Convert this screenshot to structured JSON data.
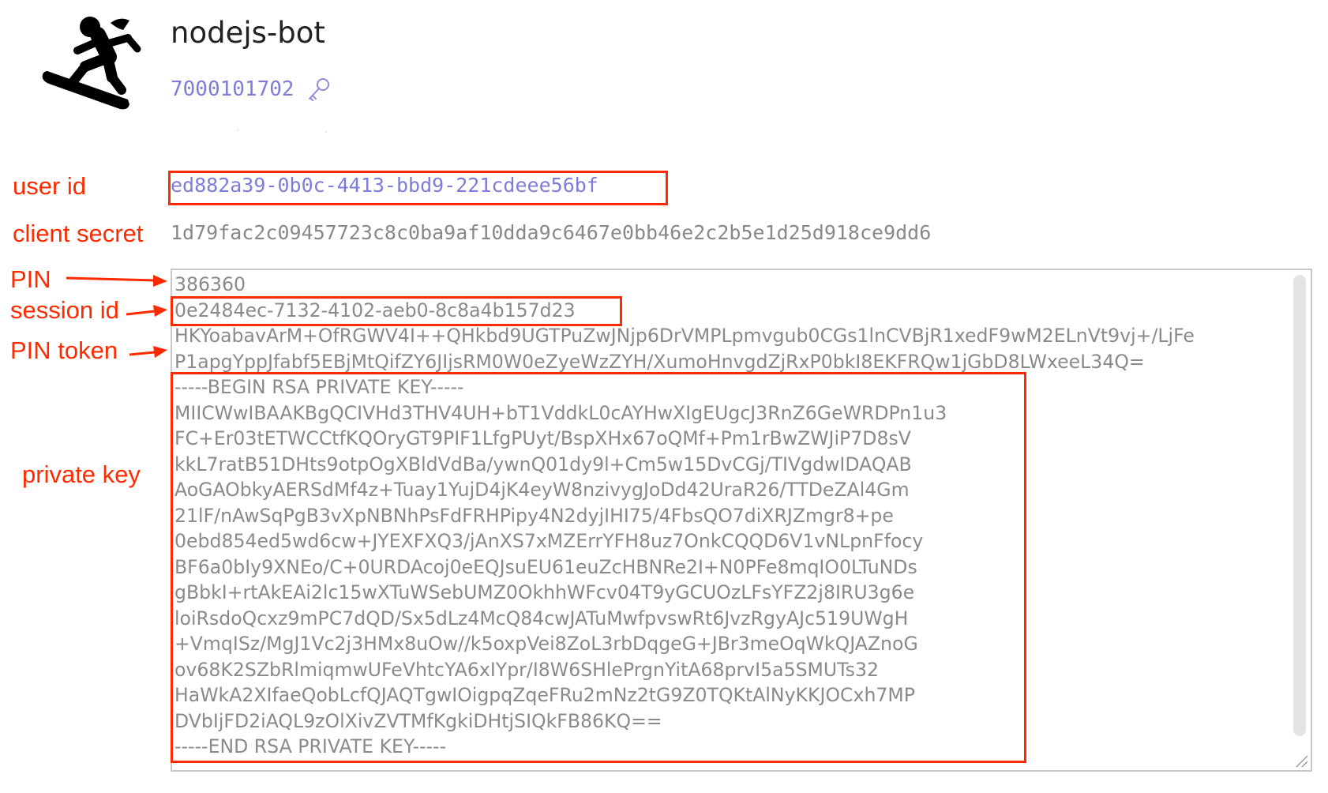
{
  "bot": {
    "name": "nodejs-bot",
    "id": "7000101702",
    "avatar_icon": "snowboarder-icon",
    "id_icon": "key-icon"
  },
  "annotations": {
    "user_id_label": "user id",
    "client_secret_label": "client secret",
    "pin_label": "PIN",
    "session_id_label": "session id",
    "pin_token_label": "PIN token",
    "private_key_label": "private key",
    "color": "#ff2a00"
  },
  "fields": {
    "user_id": "ed882a39-0b0c-4413-bbd9-221cdeee56bf",
    "client_secret": "1d79fac2c09457723c8c0ba9af10dda9c6467e0bb46e2c2b5e1d25d918ce9dd6"
  },
  "keystore": {
    "lines": [
      "386360",
      "0e2484ec-7132-4102-aeb0-8c8a4b157d23",
      "HKYoabavArM+OfRGWV4I++QHkbd9UGTPuZwJNjp6DrVMPLpmvgub0CGs1lnCVBjR1xedF9wM2ELnVt9vj+/LjFe",
      "P1apgYppJfabf5EBjMtQifZY6JIjsRM0W0eZyeWzZYH/XumoHnvgdZjRxP0bkI8EKFRQw1jGbD8LWxeeL34Q=",
      "-----BEGIN RSA PRIVATE KEY-----",
      "MIICWwIBAAKBgQCIVHd3THV4UH+bT1VddkL0cAYHwXIgEUgcJ3RnZ6GeWRDPn1u3",
      "FC+Er03tETWCCtfKQOryGT9PIF1LfgPUyt/BspXHx67oQMf+Pm1rBwZWJiP7D8sV",
      "kkL7ratB51DHts9otpOgXBldVdBa/ywnQ01dy9l+Cm5w15DvCGj/TIVgdwIDAQAB",
      "AoGAObkyAERSdMf4z+Tuay1YujD4jK4eyW8nzivygJoDd42UraR26/TTDeZAl4Gm",
      "21lF/nAwSqPgB3vXpNBNhPsFdFRHPipy4N2dyjIHI75/4FbsQO7diXRJZmgr8+pe",
      "0ebd854ed5wd6cw+JYEXFXQ3/jAnXS7xMZErrYFH8uz7OnkCQQD6V1vNLpnFfocy",
      "BF6a0bIy9XNEo/C+0URDAcoj0eEQJsuEU61euZcHBNRe2I+N0PFe8mqIO0LTuNDs",
      "gBbkI+rtAkEAi2lc15wXTuWSebUMZ0OkhhWFcv04T9yGCUOzLFsYFZ2j8IRU3g6e",
      "loiRsdoQcxz9mPC7dQD/Sx5dLz4McQ84cwJATuMwfpvswRt6JvzRgyAJc519UWgH",
      "+VmqISz/MgJ1Vc2j3HMx8uOw//k5oxpVei8ZoL3rbDqgeG+JBr3meOqWkQJAZnoG",
      "ov68K2SZbRlmiqmwUFeVhtcYA6xIYpr/I8W6SHlePrgnYitA68prvI5a5SMUTs32",
      "HaWkA2XIfaeQobLcfQJAQTgwIOigpqZqeFRu2mNz2tG9Z0TQKtAlNyKKJOCxh7MP",
      "DVbIjFD2iAQL9zOlXivZVTMfKgkiDHtjSIQkFB86KQ==",
      "-----END RSA PRIVATE KEY-----"
    ]
  }
}
